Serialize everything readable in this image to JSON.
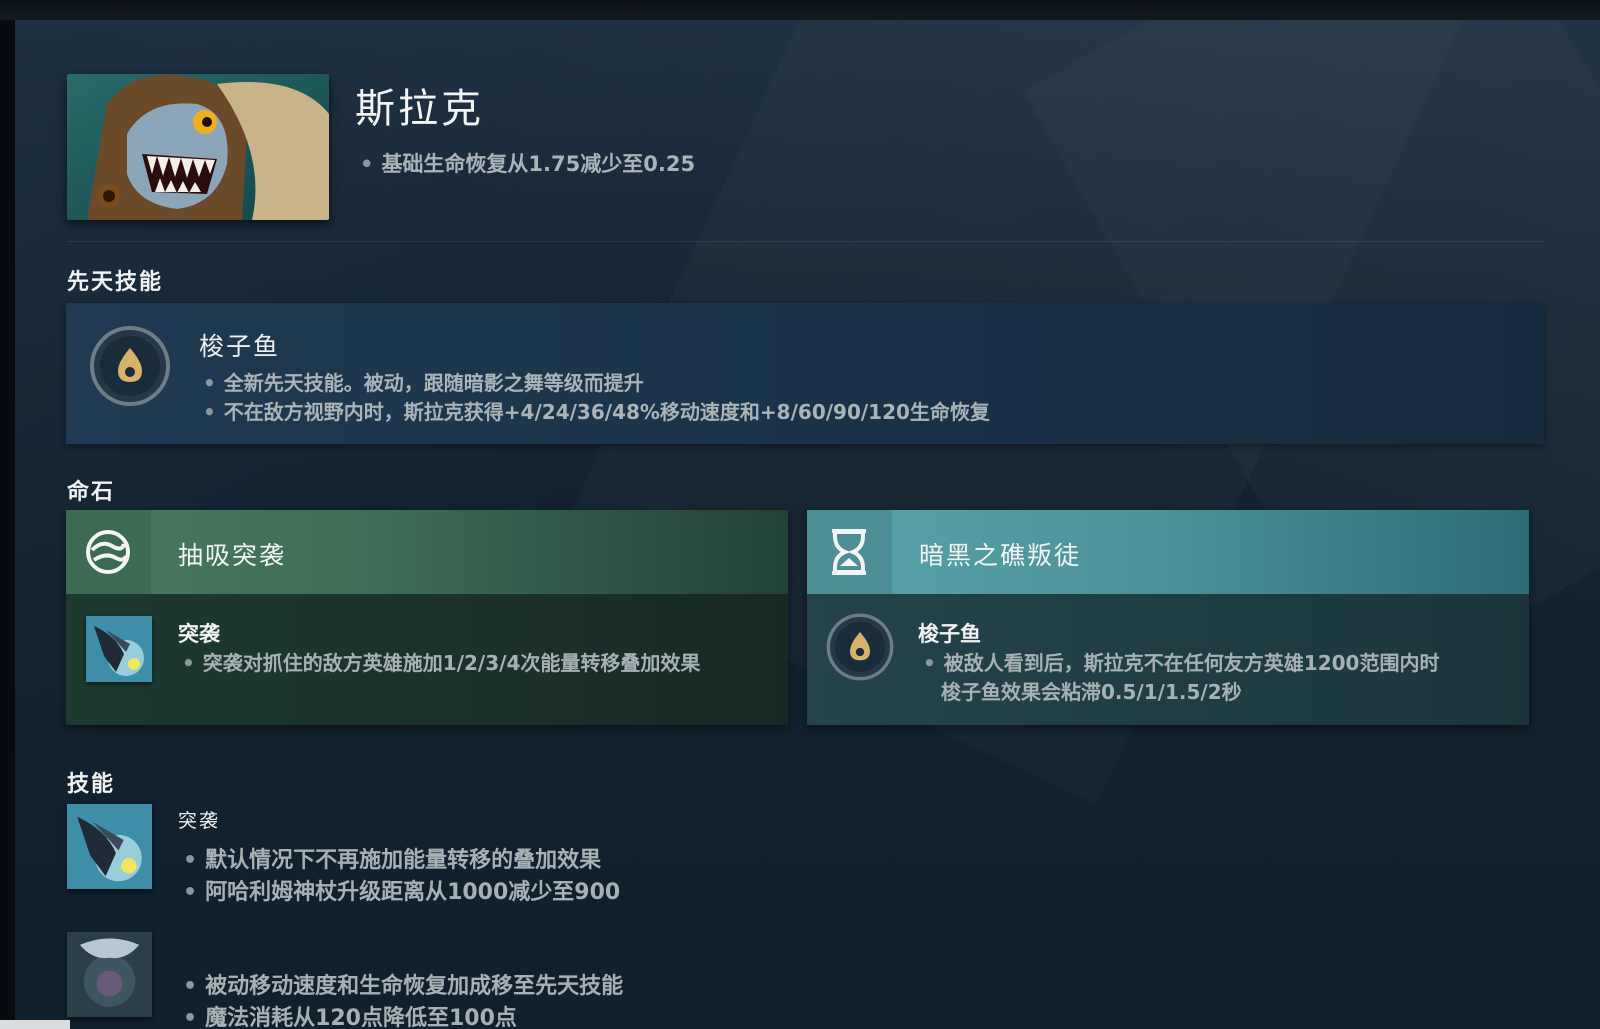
{
  "hero": {
    "name": "斯拉克",
    "notes": [
      "基础生命恢复从1.75减少至0.25"
    ]
  },
  "innate": {
    "section_title": "先天技能",
    "ability_name": "梭子鱼",
    "notes": [
      "全新先天技能。被动，跟随暗影之舞等级而提升",
      "不在敌方视野内时，斯拉克获得+4/24/36/48%移动速度和+8/60/90/120生命恢复"
    ]
  },
  "facets": {
    "section_title": "命石",
    "cards": [
      {
        "title": "抽吸突袭",
        "ability_name": "突袭",
        "notes": [
          "突袭对抓住的敌方英雄施加1/2/3/4次能量转移叠加效果"
        ]
      },
      {
        "title": "暗黑之礁叛徒",
        "ability_name": "梭子鱼",
        "notes": [
          "被敌人看到后，斯拉克不在任何友方英雄1200范围内时",
          "梭子鱼效果会粘滞0.5/1/1.5/2秒"
        ]
      }
    ]
  },
  "abilities": {
    "section_title": "技能",
    "items": [
      {
        "name": "突袭",
        "notes": [
          "默认情况下不再施加能量转移的叠加效果",
          "阿哈利姆神杖升级距离从1000减少至900"
        ]
      },
      {
        "name": "",
        "notes": [
          "被动移动速度和生命恢复加成移至先天技能",
          "魔法消耗从120点降低至100点"
        ]
      }
    ]
  },
  "colors": {
    "facet_left_accent": "#467a5f",
    "facet_right_accent": "#5aa3ac",
    "innate_panel": "#1f3a52",
    "text_note": "#a9b3b8"
  }
}
